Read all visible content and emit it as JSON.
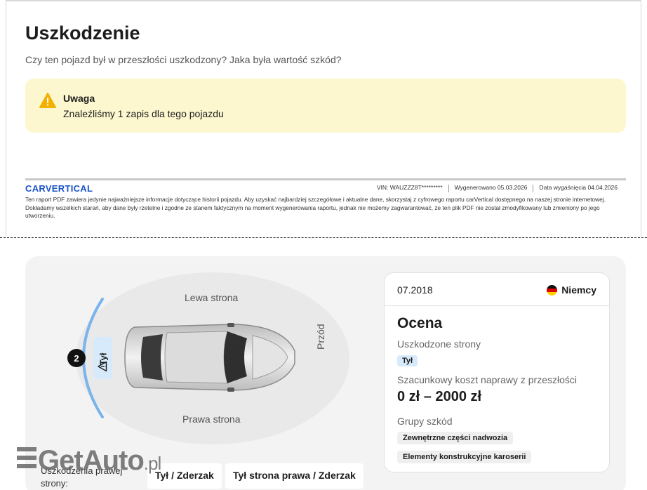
{
  "section": {
    "title": "Uszkodzenie",
    "subtitle": "Czy ten pojazd był w przeszłości uszkodzony? Jaka była wartość szkód?"
  },
  "warning": {
    "title": "Uwaga",
    "text": "Znaleźliśmy 1 zapis dla tego pojazdu",
    "icon": "warning-triangle-icon",
    "color": "#fdf7cf"
  },
  "footer": {
    "logo": "CARVERTICAL",
    "vin": "VIN: WAUZZZ8T*********",
    "generated": "Wygenerowano 05.03.2026",
    "expires": "Data wygaśnięcia 04.04.2026",
    "disclaimer": "Ten raport PDF zawiera jedynie najważniejsze informacje dotyczące historii pojazdu. Aby uzyskać najbardziej szczegółowe i aktualne dane, skorzystaj z cyfrowego raportu carVertical dostępnego na naszej stronie internetowej. Dokładamy wszelkich starań, aby dane były rzetelne i zgodne ze stanem faktycznym na moment wygenerowania raportu, jednak nie możemy zagwarantować, że ten plik PDF nie został zmodyfikowany lub zmieniony po jego utworzeniu."
  },
  "diagram": {
    "left_side": "Lewa strona",
    "right_side": "Prawa strona",
    "front": "Przód",
    "rear_tag": "Tył",
    "count": "2",
    "highlight_color": "#7ab4ec"
  },
  "record": {
    "date": "07.2018",
    "country": "Niemcy",
    "heading": "Ocena",
    "damaged_sides_label": "Uszkodzone strony",
    "damaged_side": "Tył",
    "cost_label": "Szacunkowy koszt naprawy z przeszłości",
    "cost": "0 zł – 2000 zł",
    "groups_label": "Grupy szkód",
    "groups": [
      "Zewnętrzne części nadwozia",
      "Elementy konstrukcyjne karoserii"
    ]
  },
  "bottom": {
    "label": "Uszkodzenia prawej strony:",
    "parts": [
      "Tył / Zderzak",
      "Tył strona prawa / Zderzak"
    ]
  },
  "watermark": {
    "brand": "GetAuto",
    "tld": ".pl"
  }
}
